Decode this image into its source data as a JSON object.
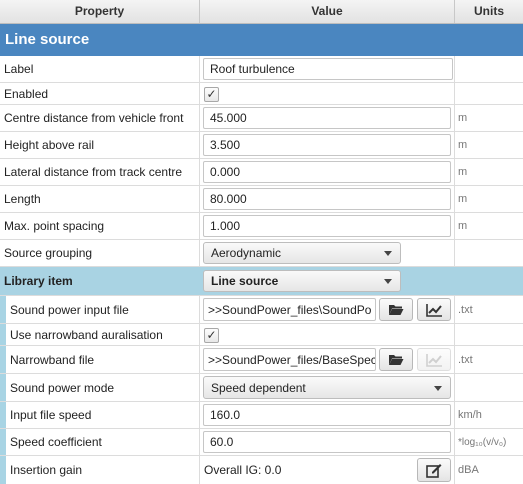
{
  "columns": {
    "property": "Property",
    "value": "Value",
    "units": "Units"
  },
  "section_title": "Line source",
  "rows": {
    "label": {
      "label": "Label",
      "value": "Roof turbulence"
    },
    "enabled": {
      "label": "Enabled",
      "checked": true,
      "check": "✓"
    },
    "centre": {
      "label": "Centre distance from vehicle front",
      "value": "45.000",
      "unit": "m"
    },
    "height": {
      "label": "Height above rail",
      "value": "3.500",
      "unit": "m"
    },
    "lateral": {
      "label": "Lateral distance from track centre",
      "value": "0.000",
      "unit": "m"
    },
    "length": {
      "label": "Length",
      "value": "80.000",
      "unit": "m"
    },
    "spacing": {
      "label": "Max. point spacing",
      "value": "1.000",
      "unit": "m"
    },
    "grouping": {
      "label": "Source grouping",
      "value": "Aerodynamic"
    }
  },
  "library": {
    "label": "Library item",
    "value": "Line source",
    "rows": {
      "spfile": {
        "label": "Sound power input file",
        "value": ">>SoundPower_files\\SoundPo",
        "unit": ".txt"
      },
      "narrowband": {
        "label": "Use narrowband auralisation",
        "checked": true,
        "check": "✓"
      },
      "nbfile": {
        "label": "Narrowband file",
        "value": ">>SoundPower_files/BaseSpec",
        "unit": ".txt"
      },
      "mode": {
        "label": "Sound power mode",
        "value": "Speed dependent"
      },
      "speed": {
        "label": "Input file speed",
        "value": "160.0",
        "unit": "km/h"
      },
      "coeff": {
        "label": "Speed coefficient",
        "value": "60.0",
        "unit": "*log₁₀(v/v₀)"
      },
      "ig": {
        "label": "Insertion gain",
        "value": "Overall IG: 0.0",
        "unit": "dBA"
      }
    }
  },
  "icons": [
    "folder-open-icon",
    "chart-icon",
    "edit-icon"
  ]
}
